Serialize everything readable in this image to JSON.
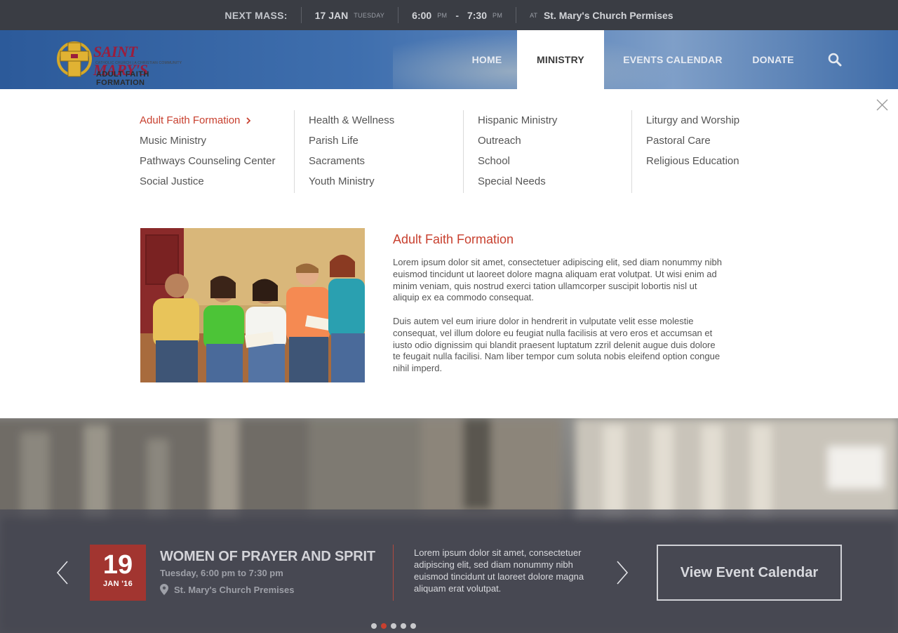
{
  "topbar": {
    "label": "NEXT MASS:",
    "date": "17 JAN",
    "weekday": "TUESDAY",
    "start_time": "6:00",
    "start_ampm": "PM",
    "dash": "-",
    "end_time": "7:30",
    "end_ampm": "PM",
    "at": "AT",
    "location": "St. Mary's Church Permises"
  },
  "logo": {
    "name": "SAINT MARY'S",
    "tagline": "CATHOLIC CHURCH  |  A CHRISTIAN COMMUNITY",
    "subtitle": "ADULT FAITH FORMATION"
  },
  "nav": {
    "items": [
      {
        "label": "HOME"
      },
      {
        "label": "MINISTRY"
      },
      {
        "label": "EVENTS CALENDAR"
      },
      {
        "label": "DONATE"
      }
    ],
    "search_icon": "search-icon"
  },
  "menu": {
    "columns": [
      [
        "Adult Faith Formation",
        "Music Ministry",
        "Pathways Counseling Center",
        "Social Justice"
      ],
      [
        "Health & Wellness",
        "Parish Life",
        "Sacraments",
        "Youth Ministry"
      ],
      [
        "Hispanic Ministry",
        "Outreach",
        "School",
        "Special Needs"
      ],
      [
        "Liturgy and Worship",
        "Pastoral Care",
        "Religious Education"
      ]
    ],
    "active": "Adult Faith Formation"
  },
  "feature": {
    "title": "Adult Faith Formation",
    "p1": "Lorem ipsum dolor sit amet, consectetuer adipiscing elit, sed diam nonummy nibh euismod tincidunt ut laoreet dolore magna aliquam erat volutpat. Ut wisi enim ad minim veniam, quis nostrud exerci tation ullamcorper suscipit lobortis nisl ut aliquip ex ea commodo consequat.",
    "p2": "Duis autem vel eum iriure dolor in hendrerit in vulputate velit esse molestie consequat, vel illum dolore eu feugiat nulla facilisis at vero eros et accumsan et iusto odio dignissim qui blandit praesent luptatum zzril delenit augue duis dolore te feugait nulla facilisi. Nam liber tempor cum soluta nobis eleifend option congue nihil imperd."
  },
  "event": {
    "day": "19",
    "month": "JAN '16",
    "title": "WOMEN OF PRAYER AND SPRIT",
    "time": "Tuesday, 6:00 pm to 7:30 pm",
    "location": "St. Mary's Church Premises",
    "description": "Lorem ipsum dolor sit amet, consectetuer adipiscing elit, sed diam nonummy nibh euismod tincidunt ut laoreet dolore magna aliquam erat volutpat.",
    "button": "View Event Calendar",
    "slide_count": 5,
    "active_slide": 2
  },
  "colors": {
    "accent": "#c8402f",
    "topbar": "#3a3d44",
    "date_box": "#a23530"
  }
}
